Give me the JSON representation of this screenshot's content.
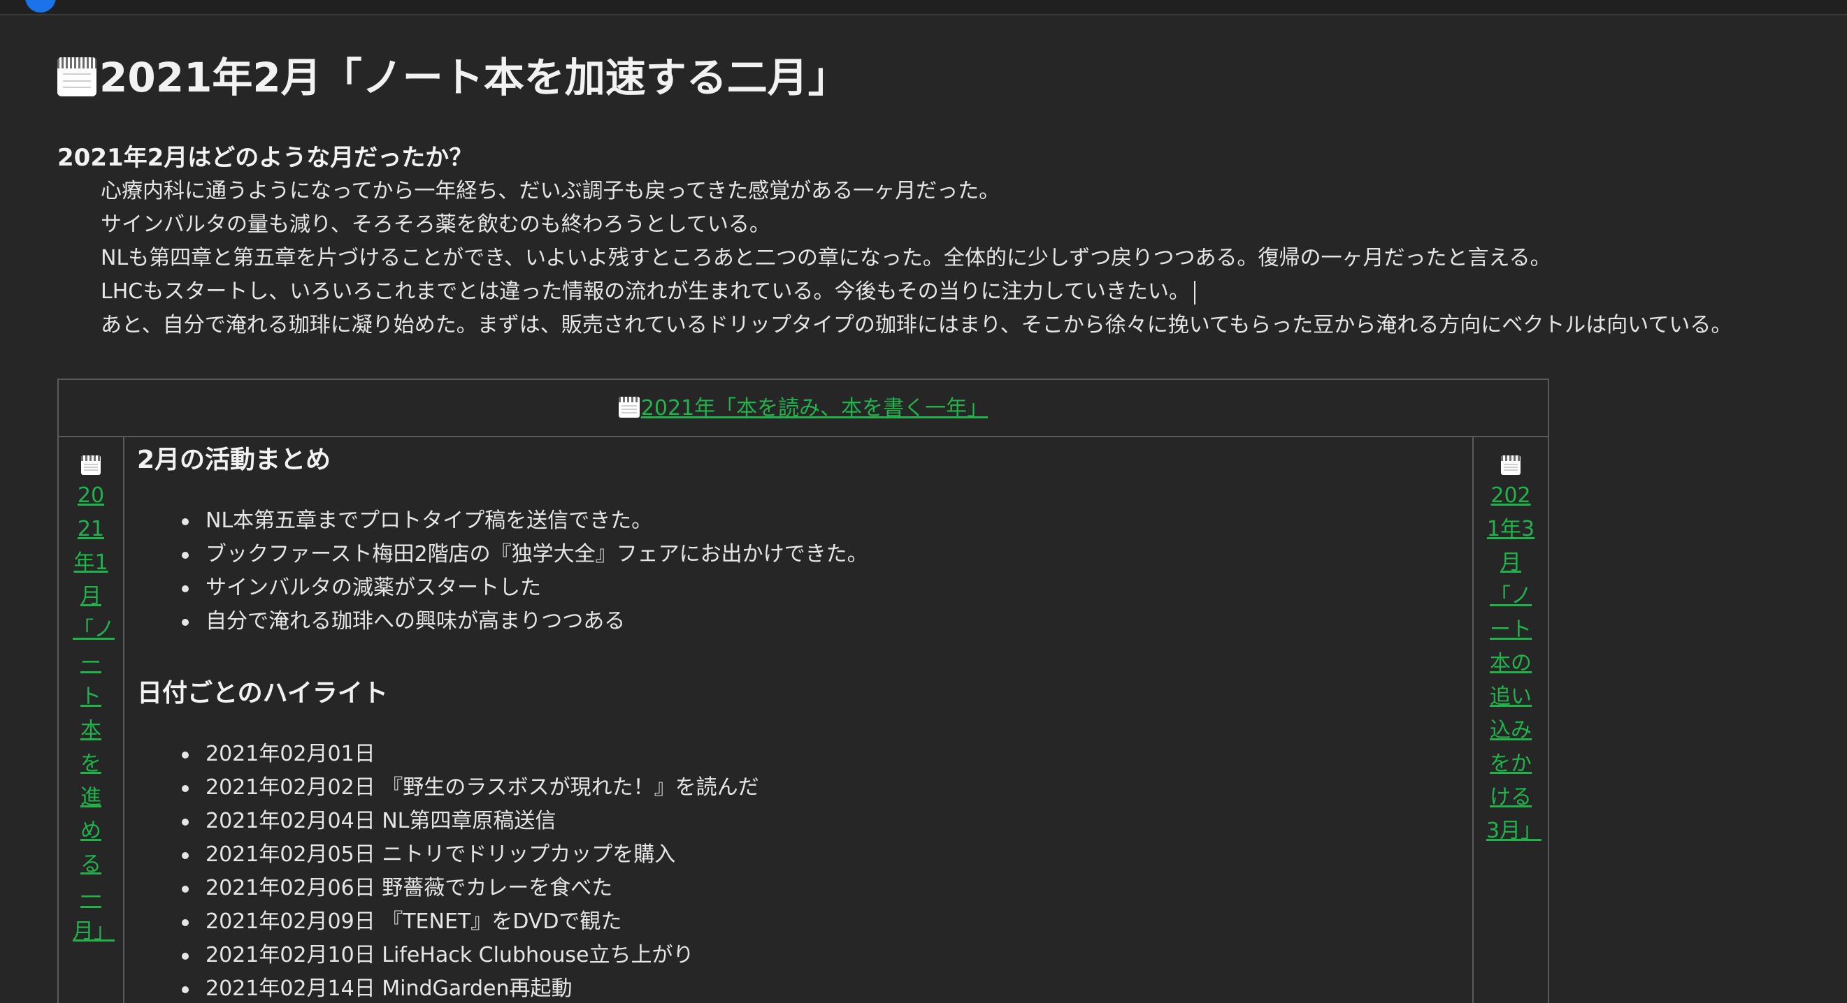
{
  "page": {
    "title": "2021年2月「ノート本を加速する二月」",
    "title_icon": "calendar-icon"
  },
  "intro": {
    "heading": "2021年2月はどのような月だったか？",
    "paragraphs": [
      "心療内科に通うようになってから一年経ち、だいぶ調子も戻ってきた感覚がある一ヶ月だった。",
      "サインバルタの量も減り、そろそろ薬を飲むのも終わろうとしている。",
      "NLも第四章と第五章を片づけることができ、いよいよ残すところあと二つの章になった。全体的に少しずつ戻りつつある。復帰の一ヶ月だったと言える。",
      "LHCもスタートし、いろいろこれまでとは違った情報の流れが生まれている。今後もその当りに注力していきたい。",
      "あと、自分で淹れる珈琲に凝り始めた。まずは、販売されているドリップタイプの珈琲にはまり、そこから徐々に挽いてもらった豆から淹れる方向にベクトルは向いている。"
    ]
  },
  "nav": {
    "year_link": "2021年「本を読み、本を書く一年」",
    "prev_link": "2021年1月「ノート本を進める一月」",
    "next_link": "2021年3月「ノート本の追い込みをかける3月」"
  },
  "activities": {
    "heading": "2月の活動まとめ",
    "items": [
      "NL本第五章までプロトタイプ稿を送信できた。",
      "ブックファースト梅田2階店の『独学大全』フェアにお出かけできた。",
      "サインバルタの減薬がスタートした",
      "自分で淹れる珈琲への興味が高まりつつある"
    ]
  },
  "highlights": {
    "heading": "日付ごとのハイライト",
    "items": [
      "2021年02月01日",
      "2021年02月02日 『野生のラスボスが現れた！』を読んだ",
      "2021年02月04日 NL第四章原稿送信",
      "2021年02月05日 ニトリでドリップカップを購入",
      "2021年02月06日 野薔薇でカレーを食べた",
      "2021年02月09日 『TENET』をDVDで観た",
      "2021年02月10日 LifeHack Clubhouse立ち上がり",
      "2021年02月14日 MindGarden再起動"
    ]
  },
  "colors": {
    "background": "#262626",
    "text": "#e6e6e6",
    "link": "#22b24c",
    "border": "#5a5a5a"
  }
}
